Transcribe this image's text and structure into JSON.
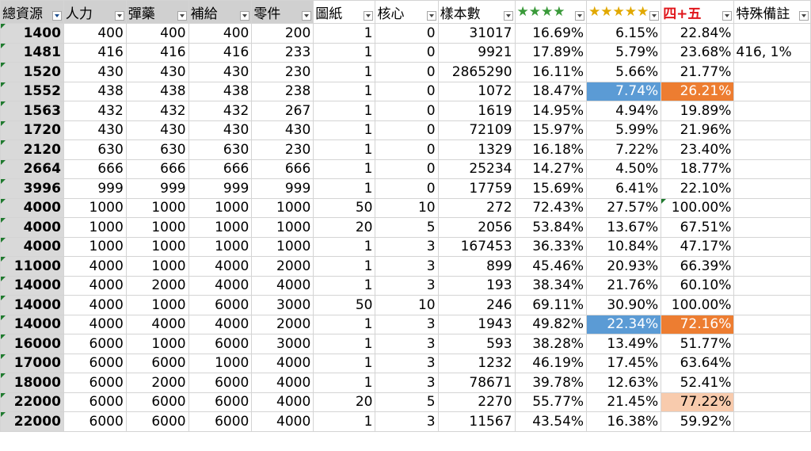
{
  "headers": [
    {
      "label": "總資源",
      "style": "gray",
      "sorted": true
    },
    {
      "label": "人力",
      "style": "gray"
    },
    {
      "label": "彈藥",
      "style": "gray"
    },
    {
      "label": "補給",
      "style": "gray"
    },
    {
      "label": "零件",
      "style": "gray"
    },
    {
      "label": "圖紙",
      "style": "plain"
    },
    {
      "label": "核心",
      "style": "plain"
    },
    {
      "label": "樣本數",
      "style": "plain"
    },
    {
      "label": "★★★★",
      "style": "green-stars"
    },
    {
      "label": "★★★★★",
      "style": "gold-stars"
    },
    {
      "label": "四+五",
      "style": "red-label"
    },
    {
      "label": "特殊備註",
      "style": "plain"
    }
  ],
  "colors": {
    "highlight_blue": "#5b9bd5",
    "highlight_orange": "#ed7d31",
    "highlight_peach": "#f8cbad",
    "header_gray": "#d0d0d0",
    "green_stars": "#3a9a3a",
    "gold_stars": "#e1a800",
    "red_label": "#e0161b"
  },
  "rows": [
    {
      "c": [
        "1400",
        "400",
        "400",
        "400",
        "200",
        "1",
        "0",
        "31017",
        "16.69%",
        "6.15%",
        "22.84%",
        ""
      ]
    },
    {
      "c": [
        "1481",
        "416",
        "416",
        "416",
        "233",
        "1",
        "0",
        "9921",
        "17.89%",
        "5.79%",
        "23.68%",
        "416, 1%"
      ]
    },
    {
      "c": [
        "1520",
        "430",
        "430",
        "430",
        "230",
        "1",
        "0",
        "2865290",
        "16.11%",
        "5.66%",
        "21.77%",
        ""
      ]
    },
    {
      "c": [
        "1552",
        "438",
        "438",
        "438",
        "238",
        "1",
        "0",
        "1072",
        "18.47%",
        "7.74%",
        "26.21%",
        ""
      ],
      "hl": {
        "9": "blue",
        "10": "orange"
      }
    },
    {
      "c": [
        "1563",
        "432",
        "432",
        "432",
        "267",
        "1",
        "0",
        "1619",
        "14.95%",
        "4.94%",
        "19.89%",
        ""
      ]
    },
    {
      "c": [
        "1720",
        "430",
        "430",
        "430",
        "430",
        "1",
        "0",
        "72109",
        "15.97%",
        "5.99%",
        "21.96%",
        ""
      ]
    },
    {
      "c": [
        "2120",
        "630",
        "630",
        "630",
        "230",
        "1",
        "0",
        "1329",
        "16.18%",
        "7.22%",
        "23.40%",
        ""
      ]
    },
    {
      "c": [
        "2664",
        "666",
        "666",
        "666",
        "666",
        "1",
        "0",
        "25234",
        "14.27%",
        "4.50%",
        "18.77%",
        ""
      ]
    },
    {
      "c": [
        "3996",
        "999",
        "999",
        "999",
        "999",
        "1",
        "0",
        "17759",
        "15.69%",
        "6.41%",
        "22.10%",
        ""
      ]
    },
    {
      "c": [
        "4000",
        "1000",
        "1000",
        "1000",
        "1000",
        "50",
        "10",
        "272",
        "72.43%",
        "27.57%",
        "100.00%",
        ""
      ],
      "tri10": true
    },
    {
      "c": [
        "4000",
        "1000",
        "1000",
        "1000",
        "1000",
        "20",
        "5",
        "2056",
        "53.84%",
        "13.67%",
        "67.51%",
        ""
      ]
    },
    {
      "c": [
        "4000",
        "1000",
        "1000",
        "1000",
        "1000",
        "1",
        "3",
        "167453",
        "36.33%",
        "10.84%",
        "47.17%",
        ""
      ]
    },
    {
      "c": [
        "11000",
        "4000",
        "1000",
        "4000",
        "2000",
        "1",
        "3",
        "899",
        "45.46%",
        "20.93%",
        "66.39%",
        ""
      ]
    },
    {
      "c": [
        "14000",
        "4000",
        "2000",
        "4000",
        "4000",
        "1",
        "3",
        "193",
        "38.34%",
        "21.76%",
        "60.10%",
        ""
      ]
    },
    {
      "c": [
        "14000",
        "4000",
        "1000",
        "6000",
        "3000",
        "50",
        "10",
        "246",
        "69.11%",
        "30.90%",
        "100.00%",
        ""
      ]
    },
    {
      "c": [
        "14000",
        "4000",
        "4000",
        "4000",
        "2000",
        "1",
        "3",
        "1943",
        "49.82%",
        "22.34%",
        "72.16%",
        ""
      ],
      "hl": {
        "9": "blue",
        "10": "orange"
      }
    },
    {
      "c": [
        "16000",
        "6000",
        "1000",
        "6000",
        "3000",
        "1",
        "3",
        "593",
        "38.28%",
        "13.49%",
        "51.77%",
        ""
      ]
    },
    {
      "c": [
        "17000",
        "6000",
        "6000",
        "1000",
        "4000",
        "1",
        "3",
        "1232",
        "46.19%",
        "17.45%",
        "63.64%",
        ""
      ]
    },
    {
      "c": [
        "18000",
        "6000",
        "2000",
        "6000",
        "4000",
        "1",
        "3",
        "78671",
        "39.78%",
        "12.63%",
        "52.41%",
        ""
      ]
    },
    {
      "c": [
        "22000",
        "6000",
        "6000",
        "6000",
        "4000",
        "20",
        "5",
        "2270",
        "55.77%",
        "21.45%",
        "77.22%",
        ""
      ],
      "hl": {
        "10": "peach"
      }
    },
    {
      "c": [
        "22000",
        "6000",
        "6000",
        "6000",
        "4000",
        "1",
        "3",
        "11567",
        "43.54%",
        "16.38%",
        "59.92%",
        ""
      ]
    }
  ]
}
